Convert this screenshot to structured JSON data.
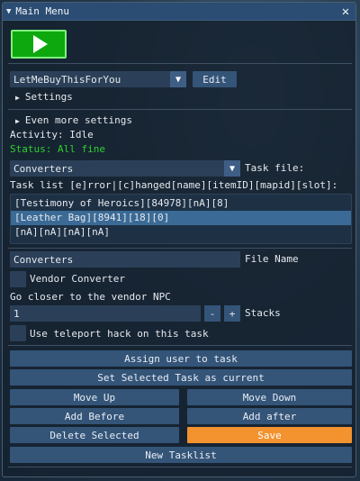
{
  "window": {
    "title": "Main Menu",
    "close_glyph": "✕",
    "collapse_glyph": "▼"
  },
  "play_button": {
    "icon": "play-icon"
  },
  "profile": {
    "selected": "LetMeBuyThisForYou",
    "edit_label": "Edit"
  },
  "settings_header": "Settings",
  "more_settings_header": "Even more settings",
  "activity": "Activity: Idle",
  "status": "Status: All fine",
  "converter_combo": {
    "selected": "Converters",
    "task_file_label": "Task file:"
  },
  "task_list": {
    "label": "Task list [e]rror|[c]hanged[name][itemID][mapid][slot]:",
    "items": [
      "[Testimony of Heroics][84978][nA][8]",
      "[Leather Bag][8941][18][0]",
      "[nA][nA][nA][nA]"
    ],
    "selected_index": 1
  },
  "file_name": {
    "value": "Converters",
    "label": "File Name"
  },
  "vendor_converter": {
    "label": "Vendor Converter",
    "checked": false
  },
  "go_closer_text": "Go closer to the vendor NPC",
  "stacks": {
    "value": "1",
    "minus": "-",
    "plus": "+",
    "label": "Stacks"
  },
  "teleport": {
    "label": "Use teleport hack on this task",
    "checked": false
  },
  "buttons": {
    "assign_user": "Assign user to task",
    "set_current": "Set Selected Task as current",
    "move_up": "Move Up",
    "move_down": "Move Down",
    "add_before": "Add Before",
    "add_after": "Add after",
    "delete_selected": "Delete Selected",
    "save": "Save",
    "new_tasklist": "New Tasklist"
  },
  "colors": {
    "accent_blue": "#345478",
    "play_green": "#0da80d",
    "status_green": "#2ed12e",
    "save_orange": "#f29330",
    "selected_row": "#3a6a95"
  }
}
